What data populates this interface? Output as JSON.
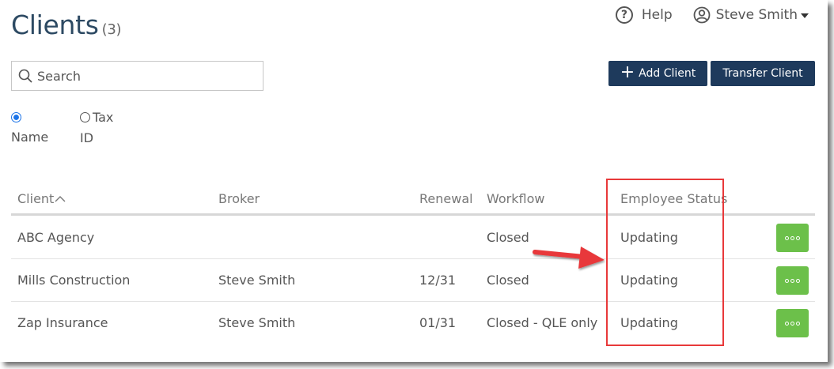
{
  "page": {
    "title": "Clients",
    "count": "(3)"
  },
  "header": {
    "help_label": "Help",
    "user_name": "Steve Smith"
  },
  "search": {
    "placeholder": "Search"
  },
  "actions": {
    "add_label": "Add Client",
    "transfer_label": "Transfer Client"
  },
  "filter": {
    "name_label_line1": "",
    "name_label_line2": "Name",
    "tax_label_line1": "Tax",
    "tax_label_line2": "ID",
    "selected": "Name"
  },
  "table": {
    "columns": {
      "client": "Client",
      "broker": "Broker",
      "renewal": "Renewal",
      "workflow": "Workflow",
      "status": "Employee Status"
    },
    "rows": [
      {
        "client": "ABC Agency",
        "broker": "",
        "renewal": "",
        "workflow": "Closed",
        "status": "Updating"
      },
      {
        "client": "Mills Construction",
        "broker": "Steve Smith",
        "renewal": "12/31",
        "workflow": "Closed",
        "status": "Updating"
      },
      {
        "client": "Zap Insurance",
        "broker": "Steve Smith",
        "renewal": "01/31",
        "workflow": "Closed - QLE only",
        "status": "Updating"
      }
    ]
  },
  "colors": {
    "primary_button": "#1e3a5c",
    "more_button": "#6cc04a",
    "annotation": "#e8393a",
    "title": "#2d4a63"
  },
  "icons": [
    "question-circle-icon",
    "user-circle-icon",
    "caret-down-icon",
    "search-icon",
    "plus-icon",
    "sort-asc-icon",
    "more-dots-icon",
    "annotation-arrow-icon"
  ]
}
